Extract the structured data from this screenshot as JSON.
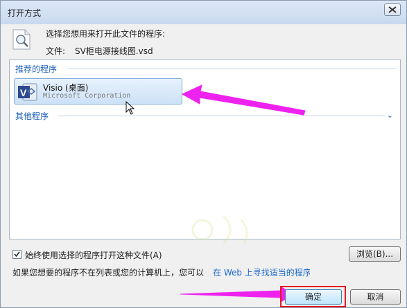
{
  "window": {
    "title": "打开方式"
  },
  "prompt": "选择您想用来打开此文件的程序:",
  "file": {
    "label": "文件:",
    "name": "SV柜电源接线图.vsd"
  },
  "groups": {
    "recommended": "推荐的程序",
    "other": "其他程序"
  },
  "programs": [
    {
      "name": "Visio (桌面)",
      "company": "Microsoft Corporation",
      "icon": "visio-icon"
    }
  ],
  "options": {
    "always_use": "始终使用选择的程序打开这种文件(A)",
    "always_use_checked": true
  },
  "buttons": {
    "browse": "浏览(B)...",
    "ok": "确定",
    "cancel": "取消"
  },
  "hint": {
    "text": "如果您想要的程序不在列表或您的计算机上，您可以",
    "link": "在 Web 上寻找适当的程序"
  },
  "annotations": {
    "arrow_color": "#ee22ee",
    "highlight_color": "#e8161e"
  }
}
